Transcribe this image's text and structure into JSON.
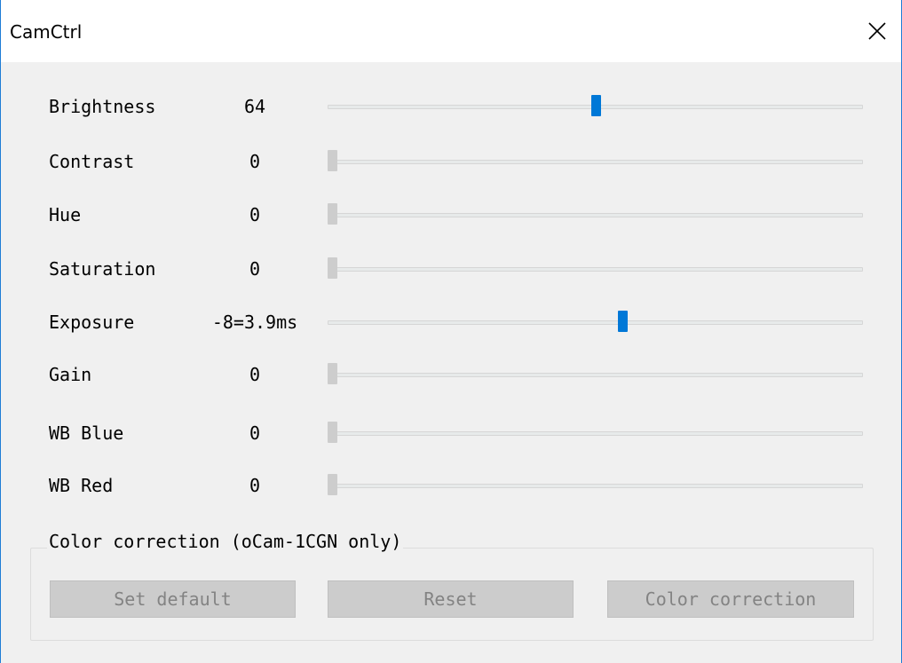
{
  "window": {
    "title": "CamCtrl",
    "close_icon": "close-icon",
    "accent_color": "#0078d7"
  },
  "controls": [
    {
      "label": "Brightness",
      "value": "64",
      "position": 0.5,
      "active": true
    },
    {
      "label": "Contrast",
      "value": "0",
      "position": 0.0,
      "active": false
    },
    {
      "label": "Hue",
      "value": "0",
      "position": 0.0,
      "active": false
    },
    {
      "label": "Saturation",
      "value": "0",
      "position": 0.0,
      "active": false
    },
    {
      "label": "Exposure",
      "value": "-8=3.9ms",
      "position": 0.55,
      "active": true
    },
    {
      "label": "Gain",
      "value": "0",
      "position": 0.0,
      "active": false
    },
    {
      "label": "WB Blue",
      "value": "0",
      "position": 0.0,
      "active": false
    },
    {
      "label": "WB Red",
      "value": "0",
      "position": 0.0,
      "active": false
    }
  ],
  "color_correction": {
    "group_label": "Color correction (oCam-1CGN only)",
    "buttons": {
      "set_default": "Set default",
      "reset": "Reset",
      "color_correction": "Color correction"
    }
  }
}
